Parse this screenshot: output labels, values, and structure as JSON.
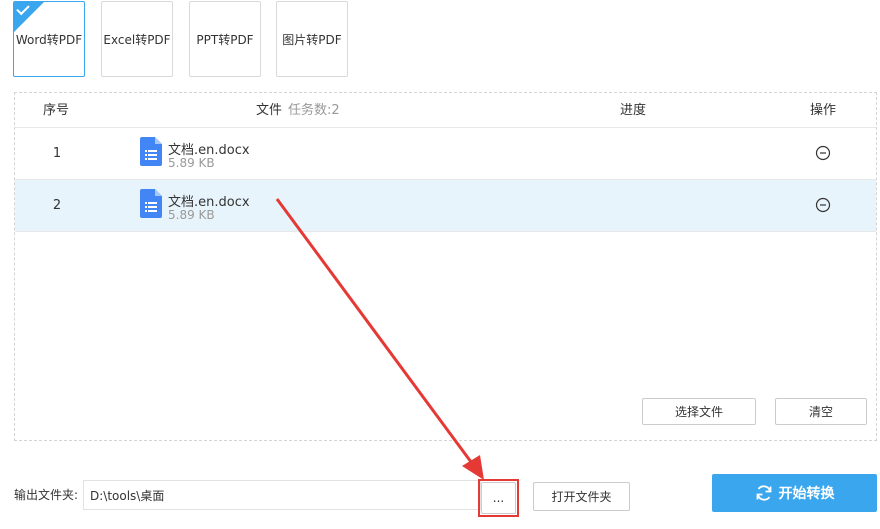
{
  "tabs": [
    {
      "label": "Word转PDF",
      "active": true
    },
    {
      "label": "Excel转PDF",
      "active": false
    },
    {
      "label": "PPT转PDF",
      "active": false
    },
    {
      "label": "图片转PDF",
      "active": false
    }
  ],
  "table": {
    "headers": {
      "index": "序号",
      "file": "文件",
      "task_count": "任务数:2",
      "progress": "进度",
      "action": "操作"
    },
    "rows": [
      {
        "index": "1",
        "name": "文档.en.docx",
        "size": "5.89 KB",
        "selected": false
      },
      {
        "index": "2",
        "name": "文档.en.docx",
        "size": "5.89 KB",
        "selected": true
      }
    ],
    "select_files": "选择文件",
    "clear": "清空"
  },
  "output": {
    "label": "输出文件夹:",
    "path": "D:\\tools\\桌面",
    "browse": "...",
    "open_folder": "打开文件夹"
  },
  "start": {
    "label": "开始转换"
  },
  "colors": {
    "accent": "#3aa6ee",
    "doc_icon": "#4285f4",
    "annotation_red": "#e53935",
    "row_selected": "#e8f4fc"
  }
}
